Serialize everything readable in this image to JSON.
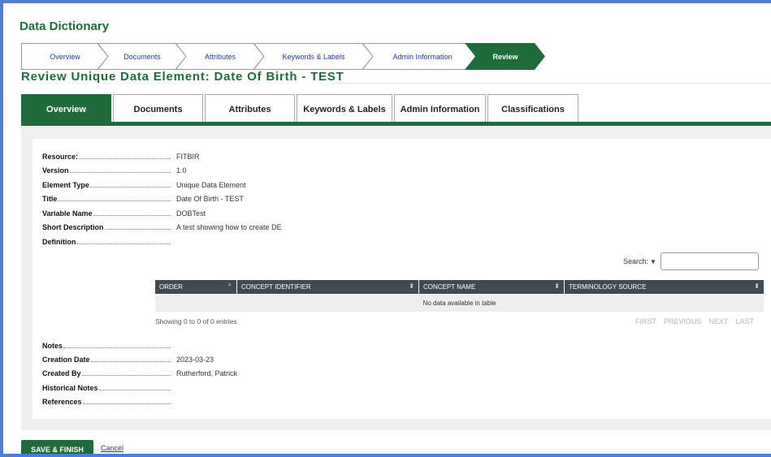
{
  "app": {
    "title": "Data Dictionary"
  },
  "wizard": {
    "steps": [
      {
        "label": "Overview"
      },
      {
        "label": "Documents"
      },
      {
        "label": "Attributes"
      },
      {
        "label": "Keywords & Labels"
      },
      {
        "label": "Admin Information"
      },
      {
        "label": "Review",
        "active": true
      }
    ]
  },
  "page": {
    "heading": "Review Unique Data Element:  Date Of Birth - TEST"
  },
  "tabs": [
    {
      "label": "Overview",
      "active": true
    },
    {
      "label": "Documents"
    },
    {
      "label": "Attributes"
    },
    {
      "label": "Keywords & Labels"
    },
    {
      "label": "Admin Information"
    },
    {
      "label": "Classifications"
    }
  ],
  "details": {
    "resource": {
      "label": "Resource:",
      "value": "FITBIR"
    },
    "version": {
      "label": "Version",
      "value": "1.0"
    },
    "element_type": {
      "label": "Element Type",
      "value": "Unique Data Element"
    },
    "title": {
      "label": "Title",
      "value": "Date Of Birth - TEST"
    },
    "variable_name": {
      "label": "Variable Name",
      "value": "DOBTest"
    },
    "short_description": {
      "label": "Short Description",
      "value": "A test showing how to create DE"
    },
    "definition": {
      "label": "Definition",
      "value": ""
    },
    "notes": {
      "label": "Notes",
      "value": ""
    },
    "creation_date": {
      "label": "Creation Date",
      "value": "2023-03-23"
    },
    "created_by": {
      "label": "Created By",
      "value": "Rutherford, Patrick"
    },
    "historical_notes": {
      "label": "Historical Notes",
      "value": ""
    },
    "references": {
      "label": "References",
      "value": ""
    }
  },
  "concepts_table": {
    "search_label": "Search:",
    "search_value": "",
    "columns": [
      "ORDER",
      "CONCEPT IDENTIFIER",
      "CONCEPT NAME",
      "TERMINOLOGY SOURCE"
    ],
    "empty_message": "No data available in table",
    "info": "Showing 0 to 0 of 0 entries",
    "pager": {
      "first": "FIRST",
      "previous": "PREVIOUS",
      "next": "NEXT",
      "last": "LAST"
    }
  },
  "footer": {
    "save_label": "SAVE & FINISH",
    "cancel_label": "Cancel"
  },
  "colors": {
    "brand_green": "#1f6b3a",
    "link_blue": "#1d3c8f",
    "frame_blue": "#4a7fd4",
    "table_header": "#3f4a52"
  },
  "icons": {
    "search_dropdown": "caret-down-icon",
    "sort": "sort-both-icon",
    "sort_asc": "sort-asc-icon"
  }
}
